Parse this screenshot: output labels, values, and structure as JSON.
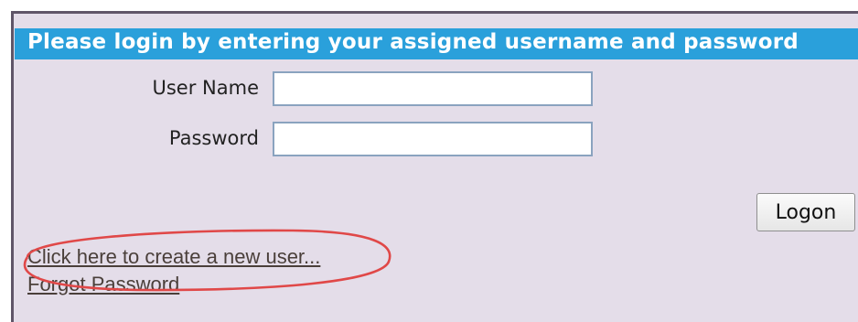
{
  "login_panel": {
    "header": "Please login by entering your assigned username and password",
    "username_label": "User Name",
    "username_value": "",
    "password_label": "Password",
    "password_value": "",
    "logon_button": "Logon",
    "create_user_link": "Click here to create a new user...",
    "forgot_password_link": "Forgot Password"
  },
  "colors": {
    "header_bar": "#2aa0db",
    "panel_background": "#e4dde9",
    "annotation": "#e04848"
  },
  "annotation": {
    "shape": "ellipse",
    "target": "create-user-link"
  }
}
